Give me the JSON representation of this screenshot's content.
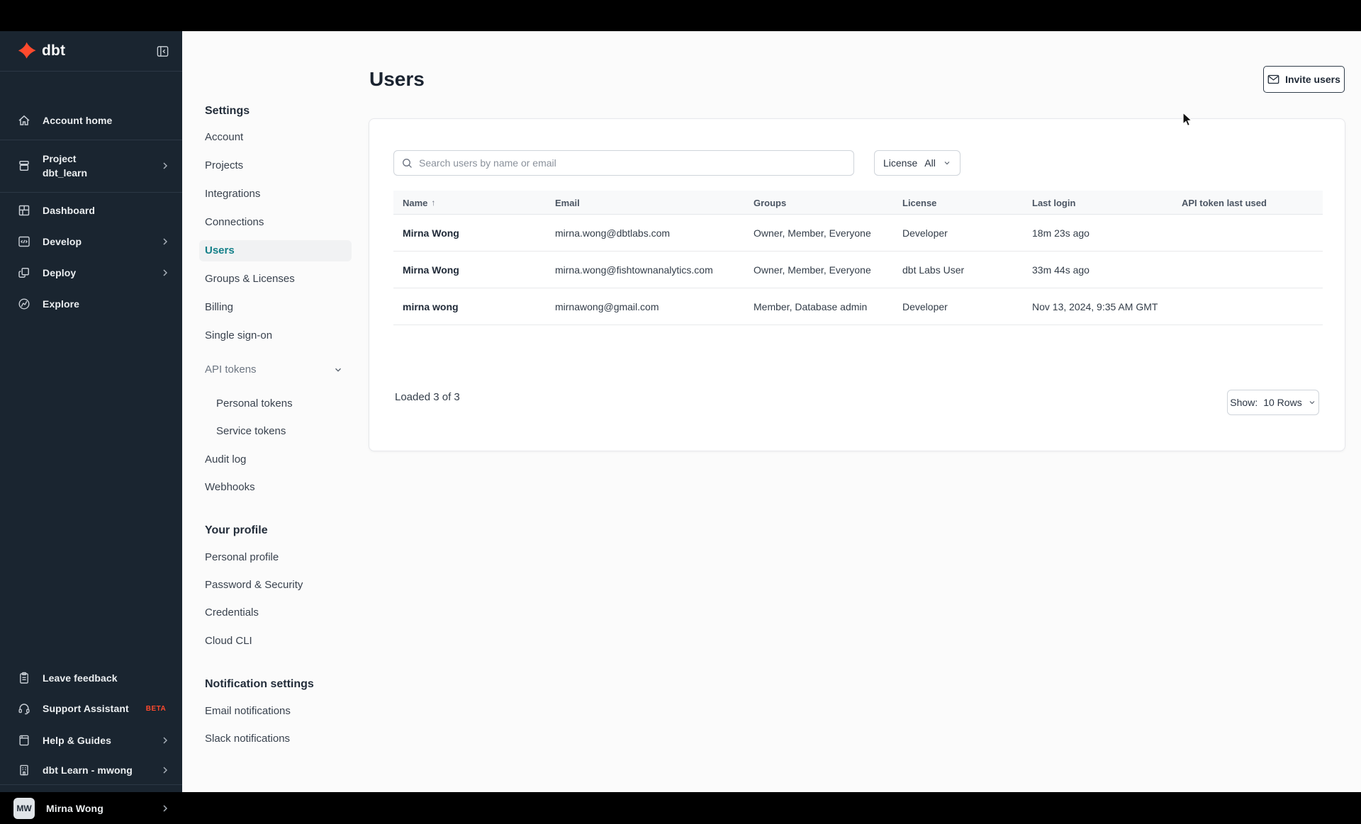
{
  "colors": {
    "accent_orange": "#FF4A2D",
    "active_teal": "#137F88",
    "sidebar_bg": "#1A2530"
  },
  "sidebar": {
    "logo_text": "dbt",
    "items": [
      {
        "label": "Account home"
      },
      {
        "label": "Project",
        "sublabel": "dbt_learn"
      },
      {
        "label": "Dashboard"
      },
      {
        "label": "Develop"
      },
      {
        "label": "Deploy"
      },
      {
        "label": "Explore"
      }
    ],
    "footer_items": [
      {
        "label": "Leave feedback"
      },
      {
        "label": "Support Assistant",
        "badge": "BETA"
      },
      {
        "label": "Help & Guides"
      },
      {
        "label": "dbt Learn - mwong"
      }
    ],
    "account": {
      "initials": "MW",
      "name": "Mirna Wong"
    }
  },
  "settings_nav": {
    "title": "Settings",
    "items": [
      "Account",
      "Projects",
      "Integrations",
      "Connections",
      "Users",
      "Groups & Licenses",
      "Billing",
      "Single sign-on"
    ],
    "api_tokens": {
      "label": "API tokens",
      "children": [
        "Personal tokens",
        "Service tokens"
      ]
    },
    "items_after": [
      "Audit log",
      "Webhooks"
    ],
    "profile": {
      "title": "Your profile",
      "items": [
        "Personal profile",
        "Password & Security",
        "Credentials",
        "Cloud CLI"
      ]
    },
    "notifications": {
      "title": "Notification settings",
      "items": [
        "Email notifications",
        "Slack notifications"
      ]
    }
  },
  "main": {
    "title": "Users",
    "invite_button_label": "Invite users",
    "search": {
      "placeholder": "Search users by name or email"
    },
    "license_filter": {
      "label": "License",
      "value": "All"
    },
    "table": {
      "columns": [
        "Name",
        "Email",
        "Groups",
        "License",
        "Last login",
        "API token last used"
      ],
      "sort_icon": "↑",
      "rows": [
        {
          "name": "Mirna Wong",
          "email": "mirna.wong@dbtlabs.com",
          "groups": "Owner, Member, Everyone",
          "license": "Developer",
          "last_login": "18m 23s ago",
          "api_token_last_used": ""
        },
        {
          "name": "Mirna Wong",
          "email": "mirna.wong@fishtownanalytics.com",
          "groups": "Owner, Member, Everyone",
          "license": "dbt Labs User",
          "last_login": "33m 44s ago",
          "api_token_last_used": ""
        },
        {
          "name": "mirna wong",
          "email": "mirnawong@gmail.com",
          "groups": "Member, Database admin",
          "license": "Developer",
          "last_login": "Nov 13, 2024, 9:35 AM GMT",
          "api_token_last_used": ""
        }
      ]
    },
    "footer": {
      "loaded": "Loaded 3 of 3",
      "show_label": "Show:",
      "show_value": "10 Rows"
    }
  }
}
